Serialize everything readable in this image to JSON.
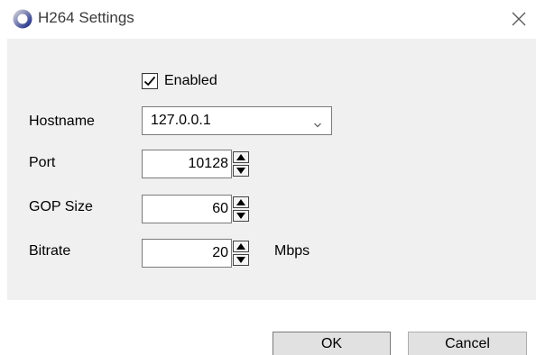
{
  "window": {
    "title": "H264 Settings",
    "icon": "ring-app-icon",
    "close": "close-icon"
  },
  "form": {
    "enabled": {
      "label": "Enabled",
      "checked": true
    },
    "hostname": {
      "label": "Hostname",
      "value": "127.0.0.1"
    },
    "port": {
      "label": "Port",
      "value": "10128"
    },
    "gop_size": {
      "label": "GOP Size",
      "value": "60"
    },
    "bitrate": {
      "label": "Bitrate",
      "value": "20",
      "unit": "Mbps"
    }
  },
  "buttons": {
    "ok": "OK",
    "cancel": "Cancel"
  },
  "colors": {
    "panel_bg": "#f0f0f0",
    "button_bg": "#e1e1e1",
    "icon_accent": "#2b3a8c"
  }
}
